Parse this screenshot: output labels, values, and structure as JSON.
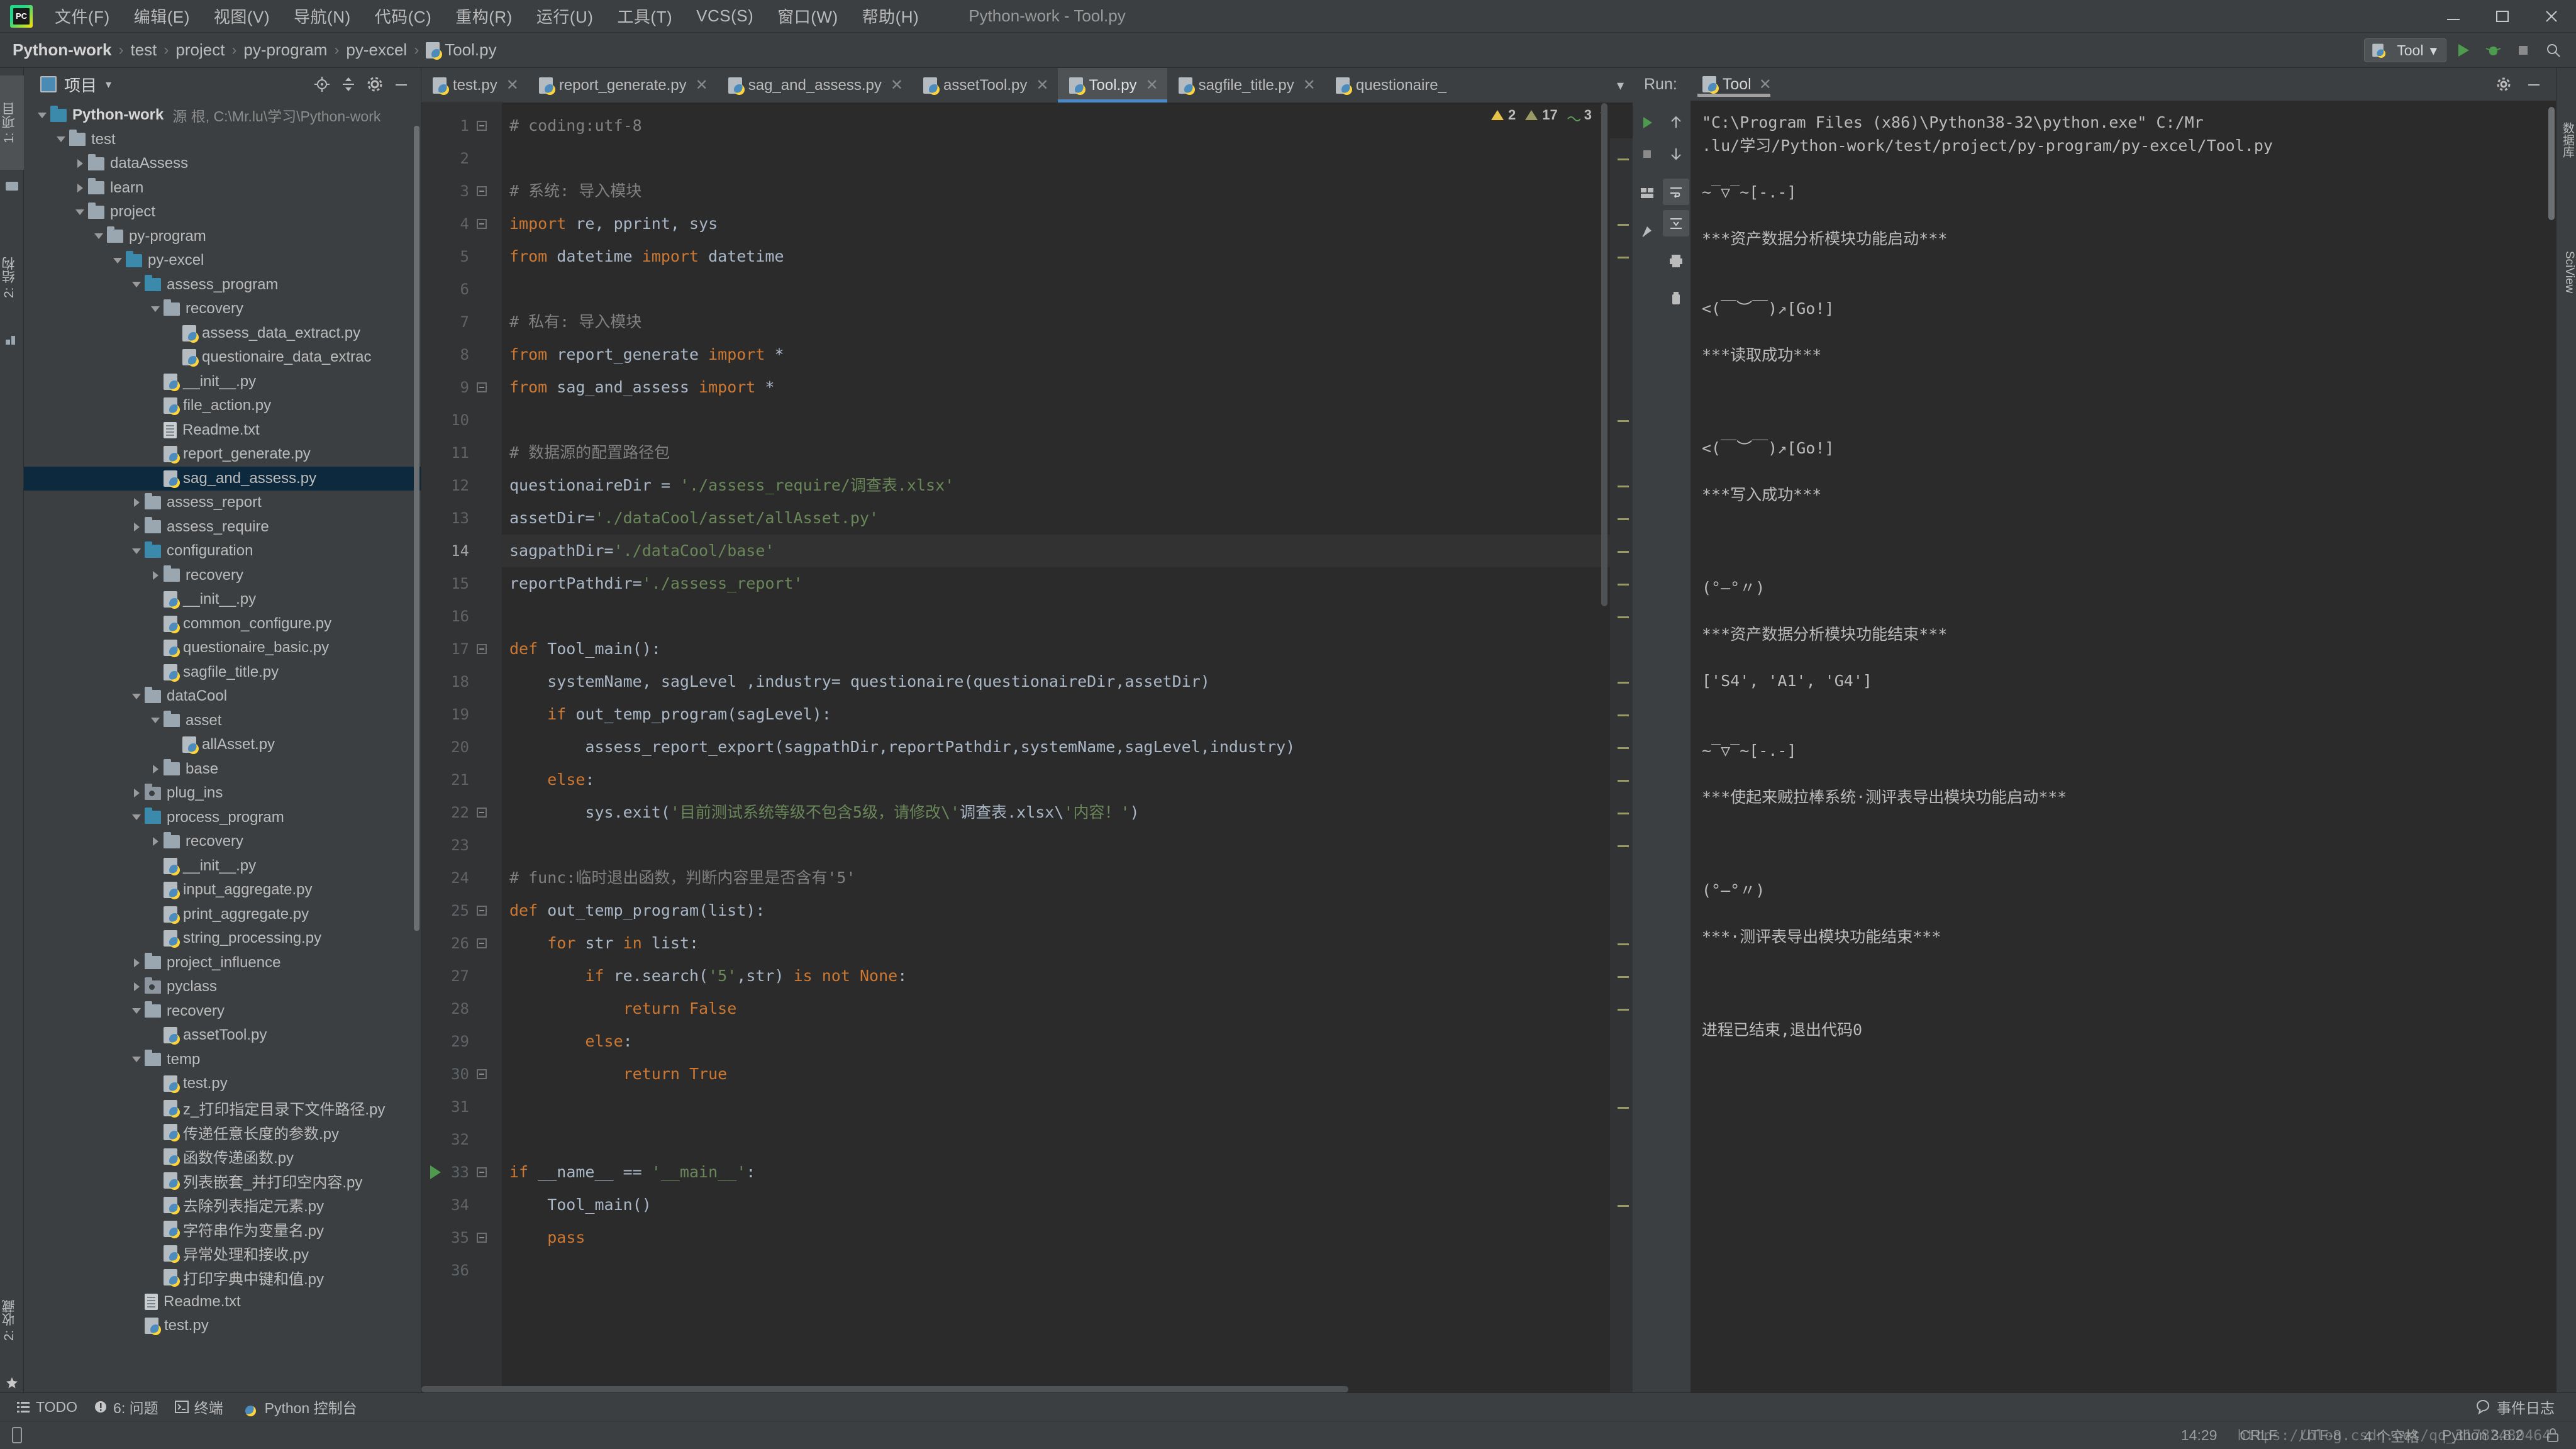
{
  "app": {
    "window_title": "Python-work - Tool.py",
    "logo_text": "PC"
  },
  "menu": {
    "items": [
      {
        "label": "文件(F)"
      },
      {
        "label": "编辑(E)"
      },
      {
        "label": "视图(V)"
      },
      {
        "label": "导航(N)"
      },
      {
        "label": "代码(C)"
      },
      {
        "label": "重构(R)"
      },
      {
        "label": "运行(U)"
      },
      {
        "label": "工具(T)"
      },
      {
        "label": "VCS(S)"
      },
      {
        "label": "窗口(W)"
      },
      {
        "label": "帮助(H)"
      }
    ]
  },
  "window_controls": {
    "minimize": "minimize-icon",
    "maximize": "maximize-icon",
    "close": "close-icon"
  },
  "breadcrumb": {
    "items": [
      "Python-work",
      "test",
      "project",
      "py-program",
      "py-excel",
      "Tool.py"
    ],
    "separator": "›"
  },
  "toolbar": {
    "run_config_label": "Tool",
    "run_config_caret": "▾",
    "run_icon": "run-icon",
    "debug_icon": "debug-icon",
    "stop_icon": "stop-icon",
    "search_icon": "search-icon"
  },
  "left_strips": {
    "project": "1: 项目",
    "structure": "2: 结构",
    "favorites": "2: 收藏"
  },
  "right_strips": {
    "database": "数据库",
    "sciview": "SciView"
  },
  "project_panel": {
    "title": "项目",
    "caret": "▾",
    "actions": [
      "locate-icon",
      "collapse-all-icon",
      "settings-icon",
      "hide-icon"
    ],
    "tree": [
      {
        "depth": 0,
        "arrow": "down",
        "icon": "folder-blue",
        "label": "Python-work",
        "bold": true,
        "meta": "源 根, C:\\Mr.lu\\学习\\Python-work"
      },
      {
        "depth": 1,
        "arrow": "down",
        "icon": "folder-grey",
        "label": "test"
      },
      {
        "depth": 2,
        "arrow": "right",
        "icon": "folder-grey",
        "label": "dataAssess"
      },
      {
        "depth": 2,
        "arrow": "right",
        "icon": "folder-grey",
        "label": "learn"
      },
      {
        "depth": 2,
        "arrow": "down",
        "icon": "folder-grey",
        "label": "project"
      },
      {
        "depth": 3,
        "arrow": "down",
        "icon": "folder-grey",
        "label": "py-program"
      },
      {
        "depth": 4,
        "arrow": "down",
        "icon": "folder-blue",
        "label": "py-excel"
      },
      {
        "depth": 5,
        "arrow": "down",
        "icon": "folder-blue",
        "label": "assess_program"
      },
      {
        "depth": 6,
        "arrow": "down",
        "icon": "folder-grey",
        "label": "recovery"
      },
      {
        "depth": 7,
        "arrow": "none",
        "icon": "py-file",
        "label": "assess_data_extract.py"
      },
      {
        "depth": 7,
        "arrow": "none",
        "icon": "py-file",
        "label": "questionaire_data_extrac"
      },
      {
        "depth": 6,
        "arrow": "none",
        "icon": "py-file",
        "label": "__init__.py"
      },
      {
        "depth": 6,
        "arrow": "none",
        "icon": "py-file",
        "label": "file_action.py"
      },
      {
        "depth": 6,
        "arrow": "none",
        "icon": "txt-file",
        "label": "Readme.txt"
      },
      {
        "depth": 6,
        "arrow": "none",
        "icon": "py-file",
        "label": "report_generate.py"
      },
      {
        "depth": 6,
        "arrow": "none",
        "icon": "py-file",
        "label": "sag_and_assess.py",
        "selected": true
      },
      {
        "depth": 5,
        "arrow": "right",
        "icon": "folder-grey",
        "label": "assess_report"
      },
      {
        "depth": 5,
        "arrow": "right",
        "icon": "folder-grey",
        "label": "assess_require"
      },
      {
        "depth": 5,
        "arrow": "down",
        "icon": "folder-blue",
        "label": "configuration"
      },
      {
        "depth": 6,
        "arrow": "right",
        "icon": "folder-grey",
        "label": "recovery"
      },
      {
        "depth": 6,
        "arrow": "none",
        "icon": "py-file",
        "label": "__init__.py"
      },
      {
        "depth": 6,
        "arrow": "none",
        "icon": "py-file",
        "label": "common_configure.py"
      },
      {
        "depth": 6,
        "arrow": "none",
        "icon": "py-file",
        "label": "questionaire_basic.py"
      },
      {
        "depth": 6,
        "arrow": "none",
        "icon": "py-file",
        "label": "sagfile_title.py"
      },
      {
        "depth": 5,
        "arrow": "down",
        "icon": "folder-grey",
        "label": "dataCool"
      },
      {
        "depth": 6,
        "arrow": "down",
        "icon": "folder-grey",
        "label": "asset"
      },
      {
        "depth": 7,
        "arrow": "none",
        "icon": "py-file",
        "label": "allAsset.py"
      },
      {
        "depth": 6,
        "arrow": "right",
        "icon": "folder-grey",
        "label": "base"
      },
      {
        "depth": 5,
        "arrow": "right",
        "icon": "folder-mod",
        "label": "plug_ins"
      },
      {
        "depth": 5,
        "arrow": "down",
        "icon": "folder-blue",
        "label": "process_program"
      },
      {
        "depth": 6,
        "arrow": "right",
        "icon": "folder-grey",
        "label": "recovery"
      },
      {
        "depth": 6,
        "arrow": "none",
        "icon": "py-file",
        "label": "__init__.py"
      },
      {
        "depth": 6,
        "arrow": "none",
        "icon": "py-file",
        "label": "input_aggregate.py"
      },
      {
        "depth": 6,
        "arrow": "none",
        "icon": "py-file",
        "label": "print_aggregate.py"
      },
      {
        "depth": 6,
        "arrow": "none",
        "icon": "py-file",
        "label": "string_processing.py"
      },
      {
        "depth": 5,
        "arrow": "right",
        "icon": "folder-grey",
        "label": "project_influence"
      },
      {
        "depth": 5,
        "arrow": "right",
        "icon": "folder-mod",
        "label": "pyclass"
      },
      {
        "depth": 5,
        "arrow": "down",
        "icon": "folder-grey",
        "label": "recovery"
      },
      {
        "depth": 6,
        "arrow": "none",
        "icon": "py-file",
        "label": "assetTool.py"
      },
      {
        "depth": 5,
        "arrow": "down",
        "icon": "folder-grey",
        "label": "temp"
      },
      {
        "depth": 6,
        "arrow": "none",
        "icon": "py-file",
        "label": "test.py"
      },
      {
        "depth": 6,
        "arrow": "none",
        "icon": "py-file",
        "label": "z_打印指定目录下文件路径.py"
      },
      {
        "depth": 6,
        "arrow": "none",
        "icon": "py-file",
        "label": "传递任意长度的参数.py"
      },
      {
        "depth": 6,
        "arrow": "none",
        "icon": "py-file",
        "label": "函数传递函数.py"
      },
      {
        "depth": 6,
        "arrow": "none",
        "icon": "py-file",
        "label": "列表嵌套_并打印空内容.py"
      },
      {
        "depth": 6,
        "arrow": "none",
        "icon": "py-file",
        "label": "去除列表指定元素.py"
      },
      {
        "depth": 6,
        "arrow": "none",
        "icon": "py-file",
        "label": "字符串作为变量名.py"
      },
      {
        "depth": 6,
        "arrow": "none",
        "icon": "py-file",
        "label": "异常处理和接收.py"
      },
      {
        "depth": 6,
        "arrow": "none",
        "icon": "py-file",
        "label": "打印字典中键和值.py"
      },
      {
        "depth": 5,
        "arrow": "none",
        "icon": "txt-file",
        "label": "Readme.txt"
      },
      {
        "depth": 5,
        "arrow": "none",
        "icon": "py-file",
        "label": "test.py"
      }
    ]
  },
  "editor": {
    "tabs": [
      {
        "label": "test.py",
        "active": false
      },
      {
        "label": "report_generate.py",
        "active": false
      },
      {
        "label": "sag_and_assess.py",
        "active": false
      },
      {
        "label": "assetTool.py",
        "active": false
      },
      {
        "label": "Tool.py",
        "active": true
      },
      {
        "label": "sagfile_title.py",
        "active": false
      },
      {
        "label": "questionaire_",
        "active": false
      }
    ],
    "tab_close_glyph": "✕",
    "tab_overflow_glyph": "▾",
    "inspection": {
      "warnings_count": "2",
      "weak_warnings_count": "17",
      "typos_count": "3",
      "caret": "▾"
    },
    "first_line": 1,
    "last_line": 36,
    "highlighted_line": 14,
    "run_marker_line": 33,
    "code_lines": [
      "# coding:utf-8",
      "",
      "# 系统: 导入模块",
      "import re, pprint, sys",
      "from datetime import datetime",
      "",
      "# 私有: 导入模块",
      "from report_generate import *",
      "from sag_and_assess import *",
      "",
      "# 数据源的配置路径包",
      "questionaireDir = './assess_require/调查表.xlsx'",
      "assetDir='./dataCool/asset/allAsset.py'",
      "sagpathDir='./dataCool/base'",
      "reportPathdir='./assess_report'",
      "",
      "def Tool_main():",
      "    systemName, sagLevel ,industry= questionaire(questionaireDir,assetDir)",
      "    if out_temp_program(sagLevel):",
      "        assess_report_export(sagpathDir,reportPathdir,systemName,sagLevel,industry)",
      "    else:",
      "        sys.exit('目前测试系统等级不包含5级，请修改\\'调查表.xlsx\\'内容！')",
      "",
      "# func:临时退出函数，判断内容里是否含有'5'",
      "def out_temp_program(list):",
      "    for str in list:",
      "        if re.search('5',str) is not None:",
      "            return False",
      "        else:",
      "            return True",
      "",
      "",
      "if __name__ == '__main__':",
      "    Tool_main()",
      "    pass",
      ""
    ]
  },
  "run_panel": {
    "label": "Run:",
    "tab_label": "Tool",
    "tab_close_glyph": "✕",
    "gutter_buttons": [
      "run-icon",
      "stop-icon",
      "layout-icon",
      "pin-icon",
      "scroll-up-icon",
      "scroll-down-icon",
      "soft-wrap-icon",
      "scroll-to-end-icon",
      "print-icon",
      "clear-all-icon"
    ],
    "header_actions": [
      "settings-icon",
      "hide-icon"
    ],
    "console_lines": [
      "\"C:\\Program Files (x86)\\Python38-32\\python.exe\" C:/Mr",
      ".lu/学习/Python-work/test/project/py-program/py-excel/Tool.py",
      "",
      "~‾▽‾~[-.-]",
      "",
      "***资产数据分析模块功能启动***",
      "",
      "",
      "<(￣︶￣)↗[Go!]",
      "",
      "***读取成功***",
      "",
      "",
      "",
      "<(￣︶￣)↗[Go!]",
      "",
      "***写入成功***",
      "",
      "",
      "",
      "(°—°〃)",
      "",
      "***资产数据分析模块功能结束***",
      "",
      "['S4', 'A1', 'G4']",
      "",
      "",
      "~‾▽‾~[-.-]",
      "",
      "***使起来贼拉棒系统·测评表导出模块功能启动***",
      "",
      "",
      "",
      "(°—°〃)",
      "",
      "***·测评表导出模块功能结束***",
      "",
      "",
      "",
      "进程已结束,退出代码0"
    ]
  },
  "tool_window_bar": {
    "items": [
      {
        "label": "TODO",
        "icon": "todo-icon"
      },
      {
        "label": "6: 问题",
        "icon": "problems-icon"
      },
      {
        "label": "终端",
        "icon": "terminal-icon"
      },
      {
        "label": "Python 控制台",
        "icon": "python-icon"
      }
    ],
    "event_log": {
      "label": "事件日志",
      "icon": "balloon-icon"
    }
  },
  "status_bar": {
    "position": "14:29",
    "line_separator": "CRLF",
    "encoding": "UTF-8",
    "indent": "4 个空格",
    "interpreter": "Python 3.8.2",
    "lock_icon": "lock-icon",
    "watermark": "https://blog.csdn.net/qq_31782480464"
  }
}
